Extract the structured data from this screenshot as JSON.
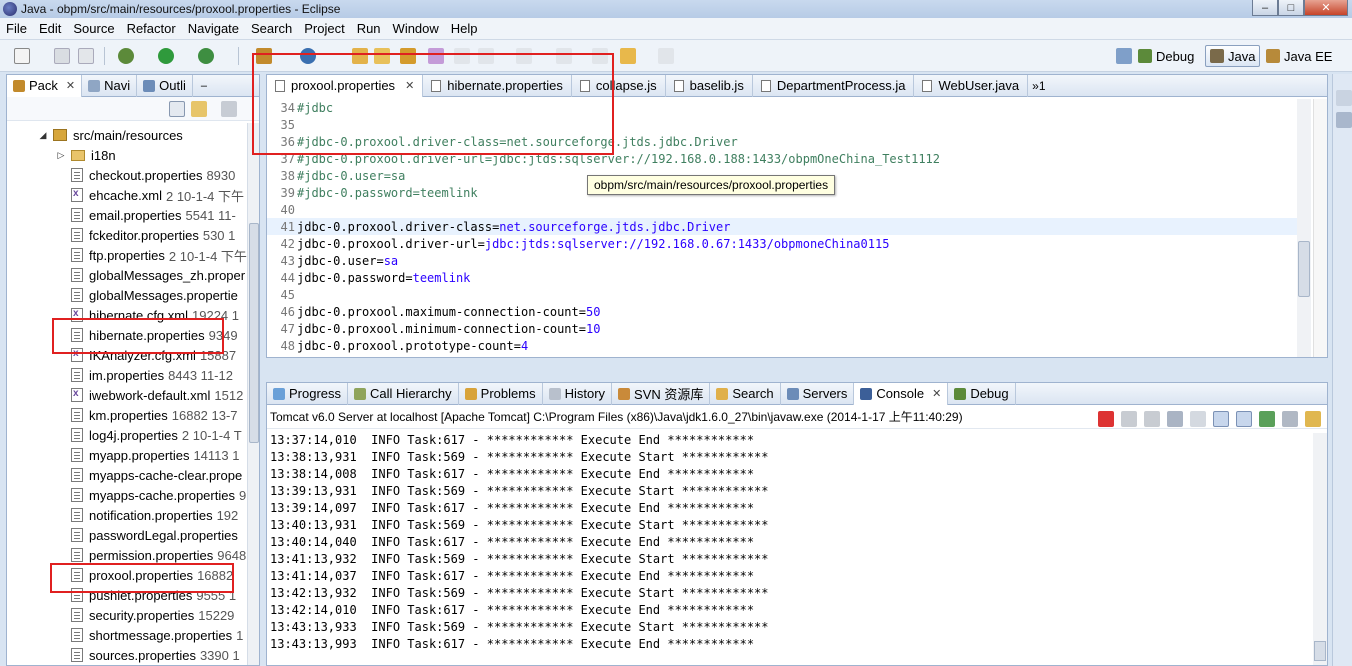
{
  "window": {
    "title": "Java - obpm/src/main/resources/proxool.properties - Eclipse"
  },
  "menu": [
    "File",
    "Edit",
    "Source",
    "Refactor",
    "Navigate",
    "Search",
    "Project",
    "Run",
    "Window",
    "Help"
  ],
  "perspectives": [
    "Debug",
    "Java",
    "Java EE"
  ],
  "left_panel": {
    "tabs": [
      {
        "label": "Pack",
        "icon": "package-explorer-icon"
      },
      {
        "label": "Navi",
        "icon": "navigator-icon"
      },
      {
        "label": "Outli",
        "icon": "outline-icon"
      }
    ],
    "folder": "src/main/resources",
    "subfolder": "i18n",
    "files": [
      {
        "name": "checkout.properties",
        "meta": "8930"
      },
      {
        "name": "ehcache.xml",
        "meta": "2  10-1-4 下午"
      },
      {
        "name": "email.properties",
        "meta": "5541  11-"
      },
      {
        "name": "fckeditor.properties",
        "meta": "530  1"
      },
      {
        "name": "ftp.properties",
        "meta": "2  10-1-4 下午"
      },
      {
        "name": "globalMessages_zh.proper",
        "meta": ""
      },
      {
        "name": "globalMessages.propertie",
        "meta": ""
      },
      {
        "name": "hibernate.cfg.xml",
        "meta": "19224  1"
      },
      {
        "name": "hibernate.properties",
        "meta": "9349"
      },
      {
        "name": "IKAnalyzer.cfg.xml",
        "meta": "15887"
      },
      {
        "name": "im.properties",
        "meta": "8443  11-12"
      },
      {
        "name": "iwebwork-default.xml",
        "meta": "1512"
      },
      {
        "name": "km.properties",
        "meta": "16882  13-7"
      },
      {
        "name": "log4j.properties",
        "meta": "2  10-1-4 T"
      },
      {
        "name": "myapp.properties",
        "meta": "14113  1"
      },
      {
        "name": "myapps-cache-clear.prope",
        "meta": ""
      },
      {
        "name": "myapps-cache.properties",
        "meta": "9"
      },
      {
        "name": "notification.properties",
        "meta": "192"
      },
      {
        "name": "passwordLegal.properties",
        "meta": ""
      },
      {
        "name": "permission.properties",
        "meta": "9648"
      },
      {
        "name": "proxool.properties",
        "meta": "16882"
      },
      {
        "name": "pushlet.properties",
        "meta": "9555  1"
      },
      {
        "name": "security.properties",
        "meta": "15229"
      },
      {
        "name": "shortmessage.properties",
        "meta": "1"
      },
      {
        "name": "sources.properties",
        "meta": "3390  1"
      }
    ]
  },
  "editor": {
    "tabs": [
      {
        "label": "proxool.properties",
        "active": true
      },
      {
        "label": "hibernate.properties",
        "active": false
      },
      {
        "label": "collapse.js",
        "active": false
      },
      {
        "label": "baselib.js",
        "active": false
      },
      {
        "label": "DepartmentProcess.ja",
        "active": false
      },
      {
        "label": "WebUser.java",
        "active": false
      }
    ],
    "overflow": "»1",
    "tooltip": "obpm/src/main/resources/proxool.properties",
    "lines": [
      {
        "n": "34",
        "text": "#jdbc",
        "kind": "comment"
      },
      {
        "n": "35",
        "text": "",
        "kind": "blank"
      },
      {
        "n": "36",
        "text": "#jdbc-0.proxool.driver-class=net.sourceforge.jtds.jdbc.Driver",
        "kind": "comment"
      },
      {
        "n": "37",
        "text": "#jdbc-0.proxool.driver-url=jdbc:jtds:sqlserver://192.168.0.188:1433/obpmOneChina_Test1112",
        "kind": "comment"
      },
      {
        "n": "38",
        "text": "#jdbc-0.user=sa",
        "kind": "comment"
      },
      {
        "n": "39",
        "text": "#jdbc-0.password=teemlink",
        "kind": "comment"
      },
      {
        "n": "40",
        "text": "",
        "kind": "blank"
      },
      {
        "n": "41",
        "key": "jdbc-0.proxool.driver-class=",
        "val": "net.sourceforge.jtds.jdbc.Driver",
        "kind": "prop",
        "hl": true
      },
      {
        "n": "42",
        "key": "jdbc-0.proxool.driver-url=",
        "val": "jdbc:jtds:sqlserver://192.168.0.67:1433/obpmoneChina0115",
        "kind": "prop"
      },
      {
        "n": "43",
        "key": "jdbc-0.user=",
        "val": "sa",
        "kind": "prop"
      },
      {
        "n": "44",
        "key": "jdbc-0.password=",
        "val": "teemlink",
        "kind": "prop"
      },
      {
        "n": "45",
        "text": "",
        "kind": "blank"
      },
      {
        "n": "46",
        "key": "jdbc-0.proxool.maximum-connection-count=",
        "val": "50",
        "kind": "prop"
      },
      {
        "n": "47",
        "key": "jdbc-0.proxool.minimum-connection-count=",
        "val": "10",
        "kind": "prop"
      },
      {
        "n": "48",
        "key": "jdbc-0.proxool.prototype-count=",
        "val": "4",
        "kind": "prop"
      }
    ]
  },
  "console": {
    "tabs": [
      {
        "label": "Progress"
      },
      {
        "label": "Call Hierarchy"
      },
      {
        "label": "Problems"
      },
      {
        "label": "History"
      },
      {
        "label": "SVN 资源库"
      },
      {
        "label": "Search"
      },
      {
        "label": "Servers"
      },
      {
        "label": "Console",
        "active": true
      },
      {
        "label": "Debug"
      }
    ],
    "header": "Tomcat v6.0 Server at localhost [Apache Tomcat] C:\\Program Files (x86)\\Java\\jdk1.6.0_27\\bin\\javaw.exe (2014-1-17 上午11:40:29)",
    "lines": [
      "13:37:14,010  INFO Task:617 - ************ Execute End ************",
      "13:38:13,931  INFO Task:569 - ************ Execute Start ************",
      "13:38:14,008  INFO Task:617 - ************ Execute End ************",
      "13:39:13,931  INFO Task:569 - ************ Execute Start ************",
      "13:39:14,097  INFO Task:617 - ************ Execute End ************",
      "13:40:13,931  INFO Task:569 - ************ Execute Start ************",
      "13:40:14,040  INFO Task:617 - ************ Execute End ************",
      "13:41:13,932  INFO Task:569 - ************ Execute Start ************",
      "13:41:14,037  INFO Task:617 - ************ Execute End ************",
      "13:42:13,932  INFO Task:569 - ************ Execute Start ************",
      "13:42:14,010  INFO Task:617 - ************ Execute End ************",
      "13:43:13,933  INFO Task:569 - ************ Execute Start ************",
      "13:43:13,993  INFO Task:617 - ************ Execute End ************"
    ]
  },
  "colors": {
    "annotation_red": "#e02020",
    "comment_green": "#3f7f5f",
    "value_blue": "#2a00ff"
  }
}
